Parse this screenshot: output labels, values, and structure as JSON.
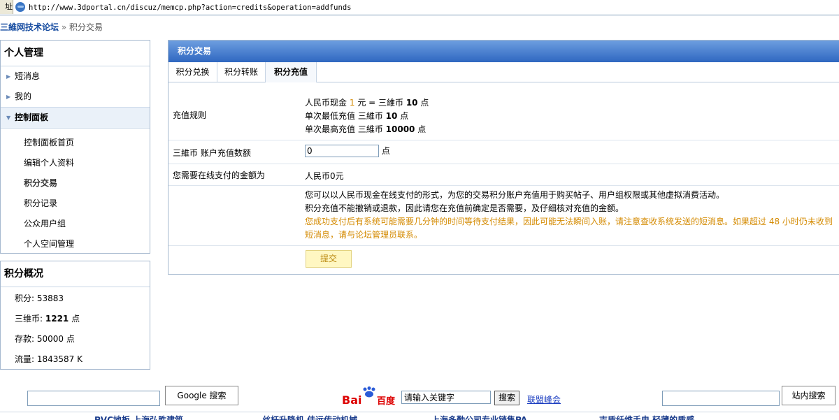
{
  "browser": {
    "address_label": "址",
    "url": "http://www.3dportal.cn/discuz/memcp.php?action=credits&operation=addfunds"
  },
  "breadcrumb": {
    "site": "三維网技术论坛",
    "sep": "»",
    "current": "积分交易"
  },
  "menu": {
    "title": "个人管理",
    "items": [
      {
        "label": "短消息"
      },
      {
        "label": "我的"
      },
      {
        "label": "控制面板"
      }
    ],
    "subitems": [
      {
        "label": "控制面板首页"
      },
      {
        "label": "编辑个人资料"
      },
      {
        "label": "积分交易"
      },
      {
        "label": "积分记录"
      },
      {
        "label": "公众用户组"
      },
      {
        "label": "个人空间管理"
      }
    ]
  },
  "stats": {
    "title": "积分概况",
    "rows": [
      {
        "label": "积分:",
        "value": "53883",
        "unit": ""
      },
      {
        "label": "三维币:",
        "value": "1221",
        "unit": "点"
      },
      {
        "label": "存款:",
        "value": "50000",
        "unit": "点"
      },
      {
        "label": "流量:",
        "value": "1843587",
        "unit": "K"
      }
    ]
  },
  "panel": {
    "title": "积分交易",
    "tabs": [
      {
        "label": "积分兑换"
      },
      {
        "label": "积分转账"
      },
      {
        "label": "积分充值"
      }
    ],
    "rules_label": "充值规则",
    "rule1": {
      "a": "人民币现金",
      "b": "1",
      "c": "元 = 三維币",
      "d": "10",
      "e": "点"
    },
    "rule2": {
      "a": "单次最低充值 三維币",
      "d": "10",
      "e": "点"
    },
    "rule3": {
      "a": "单次最高充值 三維币",
      "d": "10000",
      "e": "点"
    },
    "amount_label": "三維币 账户充值数额",
    "amount_value": "0",
    "amount_unit": "点",
    "pay_label": "您需要在线支付的金额为",
    "pay_value": "人民币0元",
    "note1": "您可以以人民币现金在线支付的形式，为您的交易积分账户充值用于购买帖子、用户组权限或其他虚拟消费活动。",
    "note2": "积分充值不能撤销或退款，因此请您在充值前确定是否需要，及仔细核对充值的金额。",
    "note3a": "您成功支付后有系统可能需要几分钟的时间等待支付结果，因此可能无法瞬间入账，请注意查收系统发送的短消息。如果超过  48 小时仍未收到",
    "note3b": "短消息，请与论坛管理员联系。",
    "submit": "提交"
  },
  "footer": {
    "google_btn": "Google 搜索",
    "baidu_placeholder": "请输入关键字",
    "baidu_btn": "搜索",
    "union_link": "联盟峰会",
    "site_btn": "站内搜索",
    "baidu_logo_bai": "Bai",
    "baidu_logo_du": "百度"
  },
  "ads": [
    {
      "text": "PVC地板 上海弘胜建筑"
    },
    {
      "text": "丝杆升降机 佳远传动机械"
    },
    {
      "text": "上海多勤公司专业销售PA"
    },
    {
      "text": "吉盾纤维手电 轻薄的质感"
    }
  ],
  "colors": {
    "accent": "#2f67c0",
    "orange": "#d48a00",
    "link": "#154ba0"
  }
}
